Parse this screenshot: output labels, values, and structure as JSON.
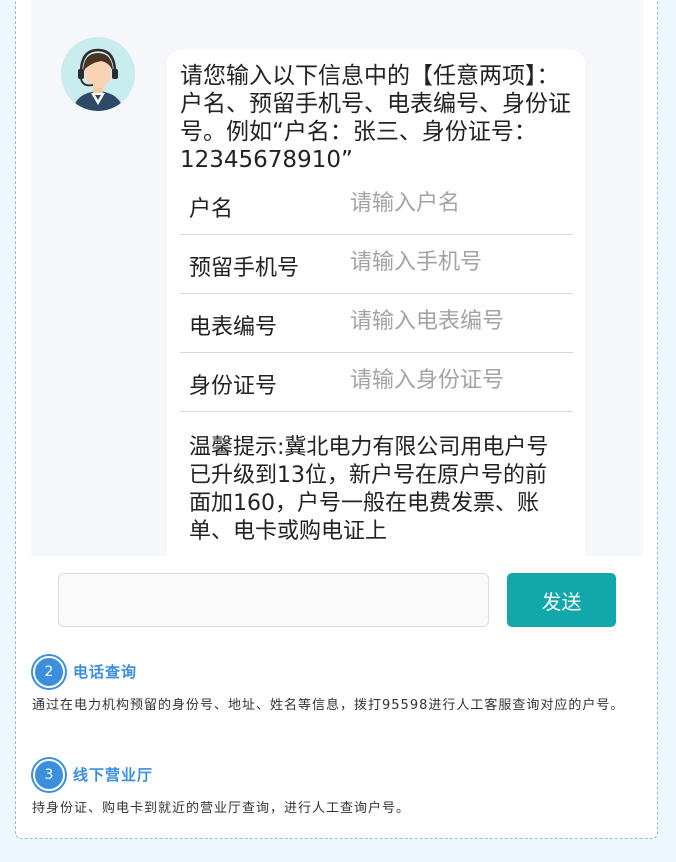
{
  "chat": {
    "prompt": "请您输入以下信息中的【任意两项】：户名、预留手机号、电表编号、身份证号。例如“户名：张三、身份证号：12345678910”",
    "fields": [
      {
        "label": "户名",
        "placeholder": "请输入户名",
        "value": ""
      },
      {
        "label": "预留手机号",
        "placeholder": "请输入手机号",
        "value": ""
      },
      {
        "label": "电表编号",
        "placeholder": "请输入电表编号",
        "value": ""
      },
      {
        "label": "身份证号",
        "placeholder": "请输入身份证号",
        "value": ""
      }
    ],
    "tip": "温馨提示:冀北电力有限公司用电户号已升级到13位，新户号在原户号的前面加160，户号一般在电费发票、账单、电卡或购电证上"
  },
  "composer": {
    "input_value": "",
    "send_label": "发送"
  },
  "steps": [
    {
      "number": "2",
      "title": "电话查询",
      "text": "通过在电力机构预留的身份号、地址、姓名等信息，拨打95598进行人工客服查询对应的户号。"
    },
    {
      "number": "3",
      "title": "线下营业厅",
      "text": "持身份证、购电卡到就近的营业厅查询，进行人工查询户号。"
    }
  ],
  "colors": {
    "accent": "#3b8fdc",
    "send_button": "#12a7aa",
    "page_background": "#eef7fd"
  },
  "icons": {
    "avatar": "customer-service-agent-icon"
  }
}
